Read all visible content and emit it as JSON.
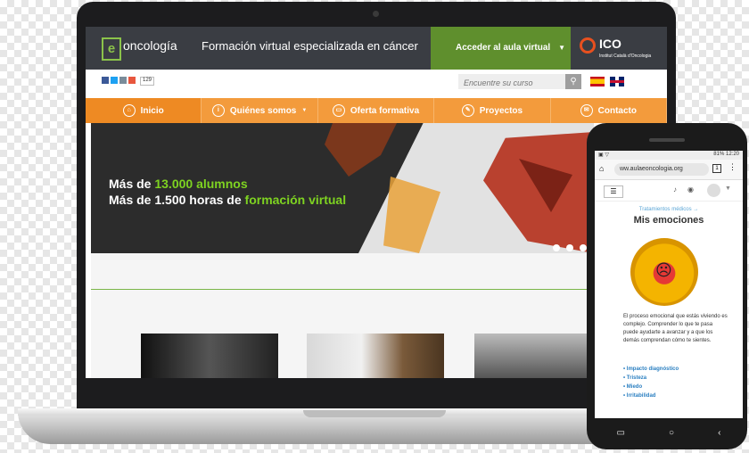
{
  "site": {
    "logo_letter": "e",
    "logo_name": "oncología",
    "tagline": "Formación virtual especializada en cáncer",
    "access_button": "Acceder al aula virtual",
    "partner_short": "ICO",
    "partner_full": "Institut Català d'Oncologia"
  },
  "social": {
    "count": "129"
  },
  "search": {
    "placeholder": "Encuentre su curso"
  },
  "nav": {
    "items": [
      {
        "label": "Inicio"
      },
      {
        "label": "Quiénes somos"
      },
      {
        "label": "Oferta formativa"
      },
      {
        "label": "Proyectos"
      },
      {
        "label": "Contacto"
      }
    ]
  },
  "hero": {
    "line1_prefix": "Más de ",
    "line1_highlight": "13.000 alumnos",
    "line2_prefix": "Más de 1.500 horas de ",
    "line2_highlight": "formación virtual"
  },
  "phone": {
    "status_time": "12:20",
    "status_battery": "81%",
    "url": "ww.aulaeoncologia.org",
    "breadcrumb": "Tratamientos médicos →",
    "title": "Mis emociones",
    "body": "El proceso emocional que estás viviendo es complejo. Comprender lo que te pasa puede ayudarte a avanzar y a que los demás comprendan cómo te sientes.",
    "links": [
      "Impacto diagnóstico",
      "Tristeza",
      "Miedo",
      "Irritabilidad"
    ]
  },
  "colors": {
    "nav_orange": "#f39b3c",
    "accent_green": "#7ed321",
    "header_dark": "#3a3d43",
    "access_green": "#5f8f2d"
  },
  "icons": {
    "social": [
      "facebook-icon",
      "twitter-icon",
      "email-icon",
      "plus-icon"
    ],
    "nav": [
      "home-icon",
      "info-icon",
      "book-icon",
      "pencil-icon",
      "envelope-icon"
    ]
  }
}
